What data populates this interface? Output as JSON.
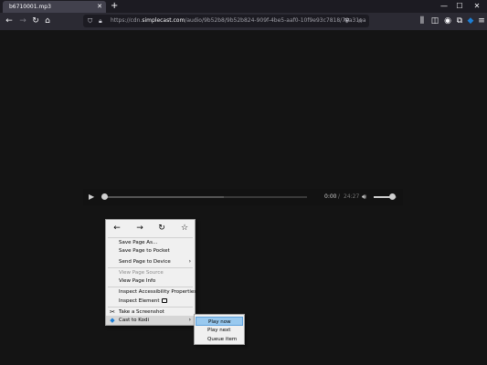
{
  "tab": {
    "title": "b6710001.mp3",
    "close_icon": "close-icon"
  },
  "tabstrip": {
    "new_tab_icon": "plus-icon"
  },
  "window_controls": {
    "minimize": "minimize-icon",
    "maximize": "maximize-icon",
    "close": "close-icon"
  },
  "navbar": {
    "back_icon": "back-arrow-icon",
    "forward_icon": "forward-arrow-icon",
    "reload_icon": "reload-icon",
    "home_icon": "home-icon",
    "url_host_prefix": "https://cdn.",
    "url_host": "simplecast.com",
    "url_path": "/audio/9b52b8/9b52b824-909f-4be5-aaf0-10f9e93c7818/70a31ea",
    "right_icons": [
      "library-icon",
      "sidebar-icon",
      "account-icon",
      "extensions-icon",
      "kodi-icon",
      "menu-icon"
    ]
  },
  "player": {
    "play_icon": "play-icon",
    "current_time": "0:00",
    "separator": "/",
    "duration": "24:27",
    "volume_icon": "volume-icon",
    "progress": 0.0,
    "buffered": 0.59,
    "volume": 0.8
  },
  "context_menu": {
    "nav": [
      "back-arrow-icon",
      "forward-arrow-icon",
      "reload-icon",
      "bookmark-star-icon"
    ],
    "items": [
      {
        "label": "Save Page As…",
        "disabled": false
      },
      {
        "label": "Save Page to Pocket",
        "disabled": false
      },
      {
        "label": "Send Page to Device",
        "disabled": false,
        "submenu": true
      },
      {
        "label": "View Page Source",
        "disabled": true
      },
      {
        "label": "View Page Info",
        "disabled": false
      },
      {
        "label": "Inspect Accessibility Properties",
        "disabled": false
      },
      {
        "label": "Inspect Element",
        "disabled": false
      },
      {
        "label": "Take a Screenshot",
        "disabled": false
      },
      {
        "label": "Cast to Kodi",
        "disabled": false,
        "submenu": true
      }
    ]
  },
  "kodi_submenu": {
    "items": [
      {
        "label": "Play now"
      },
      {
        "label": "Play next"
      },
      {
        "label": "Queue item"
      }
    ]
  },
  "colors": {
    "highlight": "#99c9ef",
    "kodi": "#1c7fd6",
    "accent_blue": "#0060df"
  }
}
